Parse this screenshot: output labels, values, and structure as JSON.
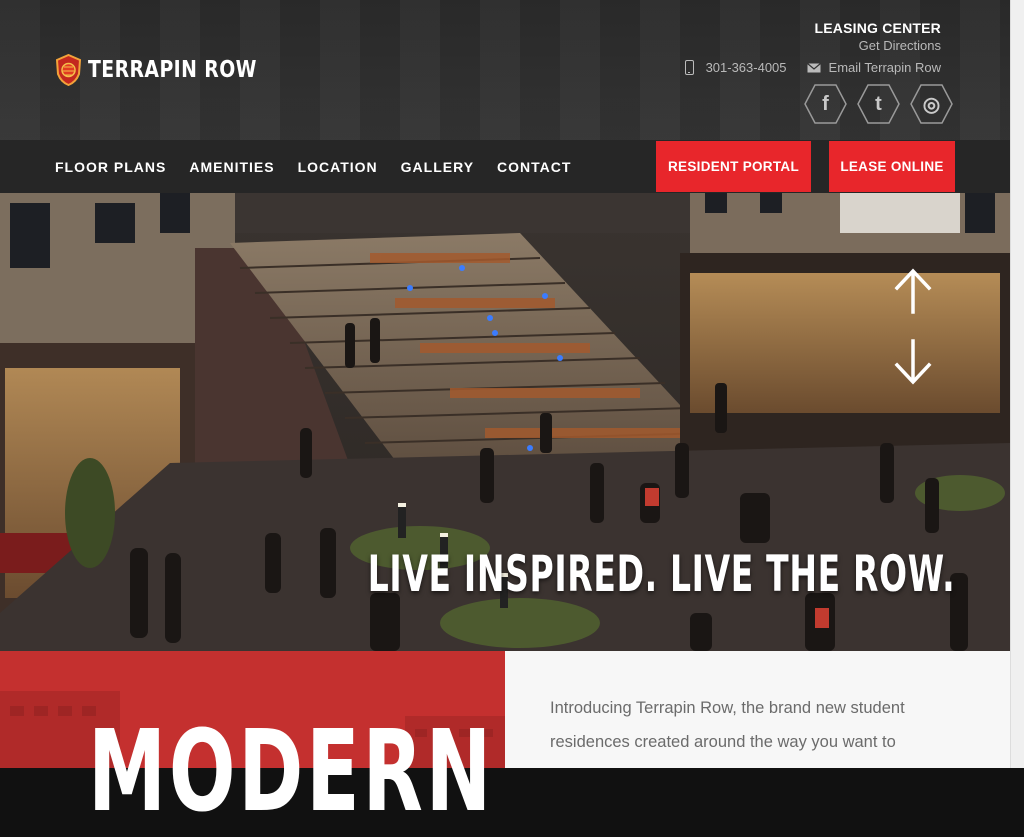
{
  "brand": {
    "name": "TERRAPIN ROW"
  },
  "leasing": {
    "title": "LEASING CENTER",
    "directions": "Get Directions"
  },
  "contact": {
    "phone": "301-363-4005",
    "email": "Email Terrapin Row"
  },
  "social": [
    {
      "icon": "facebook-icon",
      "glyph": "f"
    },
    {
      "icon": "twitter-icon",
      "glyph": "t"
    },
    {
      "icon": "instagram-icon",
      "glyph": "◎"
    }
  ],
  "nav": {
    "items": [
      "FLOOR PLANS",
      "AMENITIES",
      "LOCATION",
      "GALLERY",
      "CONTACT"
    ],
    "resident_portal": "RESIDENT PORTAL",
    "lease_online": "LEASE ONLINE"
  },
  "hero": {
    "tagline": "LIVE INSPIRED. LIVE THE ROW."
  },
  "lower": {
    "headline": "MODERN",
    "intro": "Introducing Terrapin Row, the brand new student residences created around the way you want to"
  },
  "colors": {
    "accent": "#e8262b",
    "header_bg": "#2f2f2f",
    "red_panel": "#c4302f"
  }
}
